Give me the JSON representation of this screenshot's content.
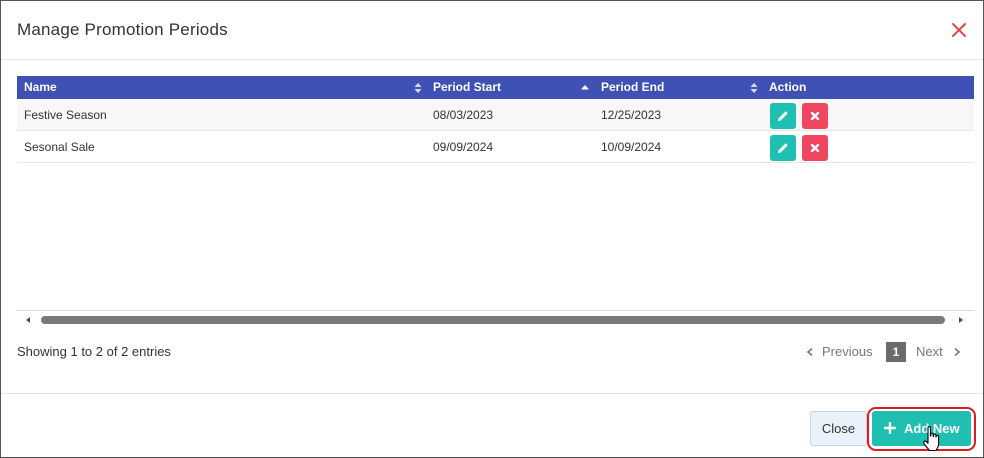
{
  "modal": {
    "title": "Manage Promotion Periods"
  },
  "table": {
    "columns": [
      {
        "key": "name",
        "label": "Name",
        "sort": "both"
      },
      {
        "key": "period_start",
        "label": "Period Start",
        "sort": "asc"
      },
      {
        "key": "period_end",
        "label": "Period End",
        "sort": "both"
      },
      {
        "key": "action",
        "label": "Action",
        "sort": "none"
      }
    ],
    "rows": [
      {
        "name": "Festive Season",
        "period_start": "08/03/2023",
        "period_end": "12/25/2023"
      },
      {
        "name": "Sesonal Sale",
        "period_start": "09/09/2024",
        "period_end": "10/09/2024"
      }
    ]
  },
  "summary": {
    "info_text": "Showing 1 to 2 of 2 entries"
  },
  "pagination": {
    "previous_label": "Previous",
    "current_page": "1",
    "next_label": "Next"
  },
  "footer": {
    "close_label": "Close",
    "add_new_label": "Add New"
  },
  "colors": {
    "header_bg": "#3f51b5",
    "edit_button": "#1fbfb1",
    "delete_button": "#f0465f",
    "primary_button": "#1fbfb1",
    "close_icon": "#e04848",
    "highlight_outline": "#e01b1b"
  },
  "icons": {
    "close": "close-icon",
    "sort_both": "sort-both-icon",
    "sort_asc": "sort-asc-icon",
    "edit": "pencil-icon",
    "delete": "x-icon",
    "previous": "chevron-left-icon",
    "next": "chevron-right-icon",
    "add": "plus-icon",
    "cursor": "hand-pointer-icon"
  }
}
